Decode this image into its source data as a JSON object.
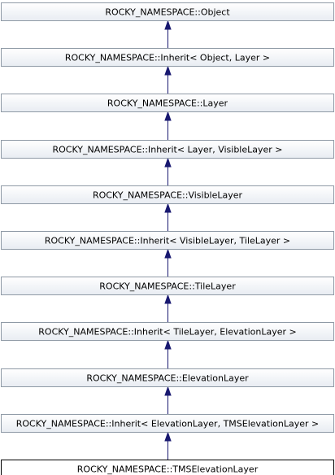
{
  "diagram": {
    "type": "inheritance",
    "colors": {
      "box_top": "#ffffff",
      "box_bottom": "#e8ecf2",
      "box_border": "#8f9aa6",
      "current_border": "#000000",
      "edge": "#191970"
    },
    "nodes": [
      {
        "id": "n0",
        "label": "ROCKY_NAMESPACE::Object",
        "current": false
      },
      {
        "id": "n1",
        "label": "ROCKY_NAMESPACE::Inherit< Object, Layer >",
        "current": false
      },
      {
        "id": "n2",
        "label": "ROCKY_NAMESPACE::Layer",
        "current": false
      },
      {
        "id": "n3",
        "label": "ROCKY_NAMESPACE::Inherit< Layer, VisibleLayer >",
        "current": false
      },
      {
        "id": "n4",
        "label": "ROCKY_NAMESPACE::VisibleLayer",
        "current": false
      },
      {
        "id": "n5",
        "label": "ROCKY_NAMESPACE::Inherit< VisibleLayer, TileLayer >",
        "current": false
      },
      {
        "id": "n6",
        "label": "ROCKY_NAMESPACE::TileLayer",
        "current": false
      },
      {
        "id": "n7",
        "label": "ROCKY_NAMESPACE::Inherit< TileLayer, ElevationLayer >",
        "current": false
      },
      {
        "id": "n8",
        "label": "ROCKY_NAMESPACE::ElevationLayer",
        "current": false
      },
      {
        "id": "n9",
        "label": "ROCKY_NAMESPACE::Inherit< ElevationLayer, TMSElevationLayer >",
        "current": false
      },
      {
        "id": "n10",
        "label": "ROCKY_NAMESPACE::TMSElevationLayer",
        "current": true
      }
    ],
    "edges": [
      {
        "from": "n1",
        "to": "n0"
      },
      {
        "from": "n2",
        "to": "n1"
      },
      {
        "from": "n3",
        "to": "n2"
      },
      {
        "from": "n4",
        "to": "n3"
      },
      {
        "from": "n5",
        "to": "n4"
      },
      {
        "from": "n6",
        "to": "n5"
      },
      {
        "from": "n7",
        "to": "n6"
      },
      {
        "from": "n8",
        "to": "n7"
      },
      {
        "from": "n9",
        "to": "n8"
      },
      {
        "from": "n10",
        "to": "n9"
      }
    ]
  }
}
